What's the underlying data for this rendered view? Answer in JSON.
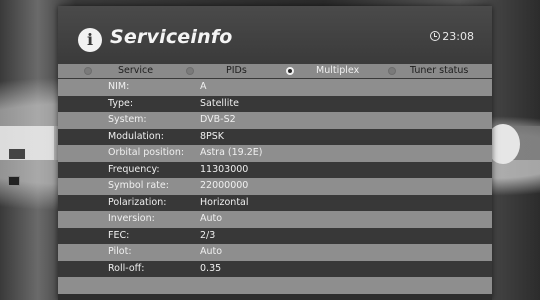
{
  "header": {
    "title": "Serviceinfo",
    "time": "23:08"
  },
  "tabs": [
    {
      "label": "Service",
      "active": false
    },
    {
      "label": "PIDs",
      "active": false
    },
    {
      "label": "Multiplex",
      "active": true
    },
    {
      "label": "Tuner status",
      "active": false
    }
  ],
  "rows": [
    {
      "label": "NIM:",
      "value": "A"
    },
    {
      "label": "Type:",
      "value": "Satellite"
    },
    {
      "label": "System:",
      "value": "DVB-S2"
    },
    {
      "label": "Modulation:",
      "value": "8PSK"
    },
    {
      "label": "Orbital position:",
      "value": "Astra (19.2E)"
    },
    {
      "label": "Frequency:",
      "value": "11303000"
    },
    {
      "label": "Symbol rate:",
      "value": "22000000"
    },
    {
      "label": "Polarization:",
      "value": "Horizontal"
    },
    {
      "label": "Inversion:",
      "value": "Auto"
    },
    {
      "label": "FEC:",
      "value": "2/3"
    },
    {
      "label": "Pilot:",
      "value": "Auto"
    },
    {
      "label": "Roll-off:",
      "value": "0.35"
    },
    {
      "label": "",
      "value": ""
    }
  ],
  "colors": {
    "panel": "#3b3b3b",
    "tab_bar": "#8a8a8a",
    "row_light": "#8e8e8e",
    "row_dark": "#383838",
    "text": "#f0f0f0"
  }
}
